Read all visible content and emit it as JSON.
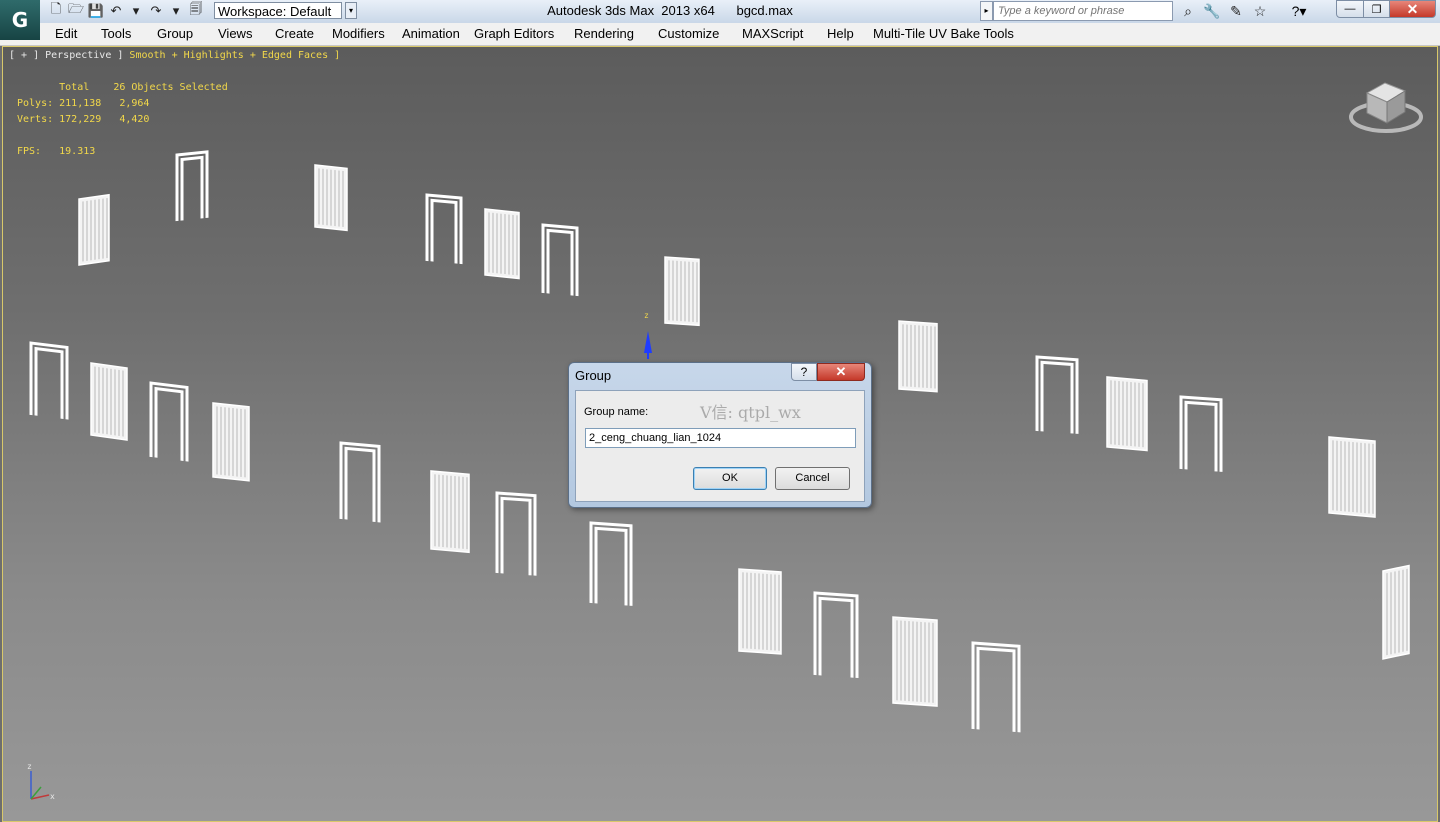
{
  "app": {
    "logo": "G",
    "title": "Autodesk 3ds Max  2013 x64      bgcd.max",
    "workspace": "Workspace: Default",
    "search_placeholder": "Type a keyword or phrase"
  },
  "quick_access": [
    {
      "icon": "new-file-icon",
      "glyph": "🗋"
    },
    {
      "icon": "open-folder-icon",
      "glyph": "🗁"
    },
    {
      "icon": "save-icon",
      "glyph": "💾"
    },
    {
      "icon": "undo-icon",
      "glyph": "↶"
    },
    {
      "icon": "undo-dropdown-icon",
      "glyph": "▾"
    },
    {
      "icon": "redo-icon",
      "glyph": "↷"
    },
    {
      "icon": "redo-dropdown-icon",
      "glyph": "▾"
    },
    {
      "icon": "project-folder-icon",
      "glyph": "🗐"
    }
  ],
  "toolbar_right": [
    {
      "icon": "binoculars-icon",
      "glyph": "⌕"
    },
    {
      "icon": "wrench-icon",
      "glyph": "🔧"
    },
    {
      "icon": "subscription-icon",
      "glyph": "✎"
    },
    {
      "icon": "favorites-star-icon",
      "glyph": "☆"
    }
  ],
  "help_glyph": "?▾",
  "window_controls": {
    "minimize": "—",
    "maximize": "❐",
    "close": "✕"
  },
  "menu": [
    "Edit",
    "Tools",
    "Group",
    "Views",
    "Create",
    "Modifiers",
    "Animation",
    "Graph Editors",
    "Rendering",
    "Customize",
    "MAXScript",
    "Help",
    "Multi-Tile UV Bake Tools"
  ],
  "viewport": {
    "label_prefix": "[ + ] Perspective ] ",
    "label_shading": "Smooth + Highlights + Edged Faces ]",
    "stats": {
      "header": "       Total    26 Objects Selected",
      "polys": "Polys: 211,138   2,964",
      "verts": "Verts: 172,229   4,420",
      "fps": "FPS:   19.313"
    },
    "gizmo_axis": "z",
    "tripod": {
      "z": "z",
      "x": "x"
    }
  },
  "watermark": "V信: qtpl_wx",
  "dialog": {
    "title": "Group",
    "help": "?",
    "close": "✕",
    "label": "Group name:",
    "value": "2_ceng_chuang_lian_1024",
    "ok": "OK",
    "cancel": "Cancel"
  },
  "colors": {
    "accent_yellow": "#f2d84a",
    "viewport_top": "#5c5c5c",
    "viewport_bottom": "#989898",
    "object_white": "#ffffff"
  }
}
